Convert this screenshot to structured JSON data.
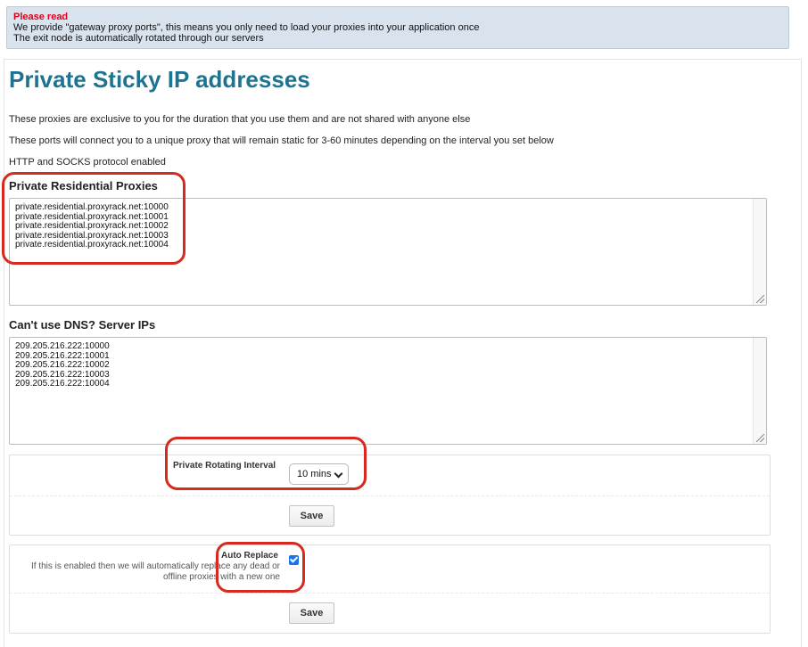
{
  "notice": {
    "title": "Please read",
    "lines": [
      "We provide \"gateway proxy ports\", this means you only need to load your proxies into your application once",
      "The exit node is automatically rotated through our servers"
    ]
  },
  "page": {
    "title": "Private Sticky IP addresses",
    "descriptions": [
      "These proxies are exclusive to you for the duration that you use them and are not shared with anyone else",
      "These ports will connect you to a unique proxy that will remain static for 3-60 minutes depending on the interval you set below",
      "HTTP and SOCKS protocol enabled"
    ]
  },
  "residential": {
    "label": "Private Residential Proxies",
    "proxies": [
      "private.residential.proxyrack.net:10000",
      "private.residential.proxyrack.net:10001",
      "private.residential.proxyrack.net:10002",
      "private.residential.proxyrack.net:10003",
      "private.residential.proxyrack.net:10004"
    ]
  },
  "server_ips": {
    "label": "Can't use DNS? Server IPs",
    "proxies": [
      "209.205.216.222:10000",
      "209.205.216.222:10001",
      "209.205.216.222:10002",
      "209.205.216.222:10003",
      "209.205.216.222:10004"
    ]
  },
  "rotating": {
    "label": "Private Rotating Interval",
    "selected": "10 mins",
    "save_label": "Save"
  },
  "auto_replace": {
    "label": "Auto Replace",
    "help": "If this is enabled then we will automatically replace any dead or offline proxies with a new one",
    "checked": true,
    "save_label": "Save"
  },
  "colors": {
    "title": "#1e7490",
    "notice_title": "#e0001a",
    "notice_bg": "#d9e3ee",
    "highlight": "#d52a1d",
    "checkbox": "#1a73e8"
  }
}
